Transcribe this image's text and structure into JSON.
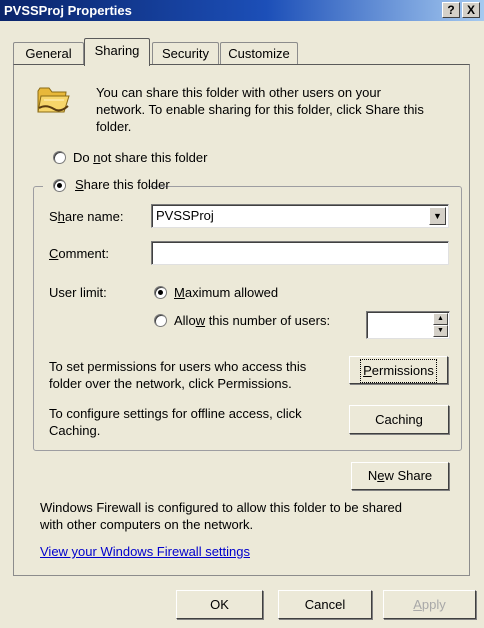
{
  "window": {
    "title": "PVSSProj Properties",
    "help_glyph": "?",
    "close_glyph": "X"
  },
  "tabs": [
    {
      "label": "General",
      "active": false
    },
    {
      "label": "Sharing",
      "active": true
    },
    {
      "label": "Security",
      "active": false
    },
    {
      "label": "Customize",
      "active": false
    }
  ],
  "sharing": {
    "icon": "shared-folder-icon",
    "intro_lines": [
      "You can share this folder with other users on your",
      "network.  To enable sharing for this folder, click Share this",
      "folder."
    ],
    "do_not_share_label": {
      "pre": "Do ",
      "key": "n",
      "post": "ot share this folder"
    },
    "share_label": {
      "pre": "",
      "key": "S",
      "post": "hare this folder"
    },
    "selected_option": "share",
    "share_name_label": {
      "pre": "S",
      "key": "h",
      "post": "are name:"
    },
    "share_name_value": "PVSSProj",
    "comment_label": {
      "pre": "",
      "key": "C",
      "post": "omment:"
    },
    "comment_value": "",
    "user_limit_label": "User limit:",
    "max_allowed_label": {
      "pre": "",
      "key": "M",
      "post": "aximum allowed"
    },
    "allow_number_label": {
      "pre": "Allo",
      "key": "w",
      "post": " this number of users:"
    },
    "user_limit_selected": "maximum",
    "user_count_value": "",
    "permissions_text_lines": [
      "To set permissions for users who access this",
      "folder over the network, click Permissions."
    ],
    "permissions_button": {
      "pre": "",
      "key": "P",
      "post": "ermissions"
    },
    "caching_text_lines": [
      "To configure settings for offline access, click",
      "Caching."
    ],
    "caching_button": {
      "pre": "Cachin",
      "key": "g",
      "post": ""
    },
    "new_share_button": {
      "pre": "N",
      "key": "e",
      "post": "w Share"
    },
    "firewall_text_lines": [
      "Windows Firewall is configured to allow this folder to be shared",
      "with other computers on the network."
    ],
    "firewall_link": "View your Windows Firewall settings"
  },
  "footer": {
    "ok_label": "OK",
    "cancel_label": "Cancel",
    "apply_label": {
      "pre": "",
      "key": "A",
      "post": "pply"
    },
    "apply_enabled": false
  },
  "colors": {
    "face": "#ece9d8",
    "title_start": "#0a246a",
    "title_end": "#a6caf0",
    "link": "#0000cc",
    "disabled": "#a8a8a8"
  }
}
